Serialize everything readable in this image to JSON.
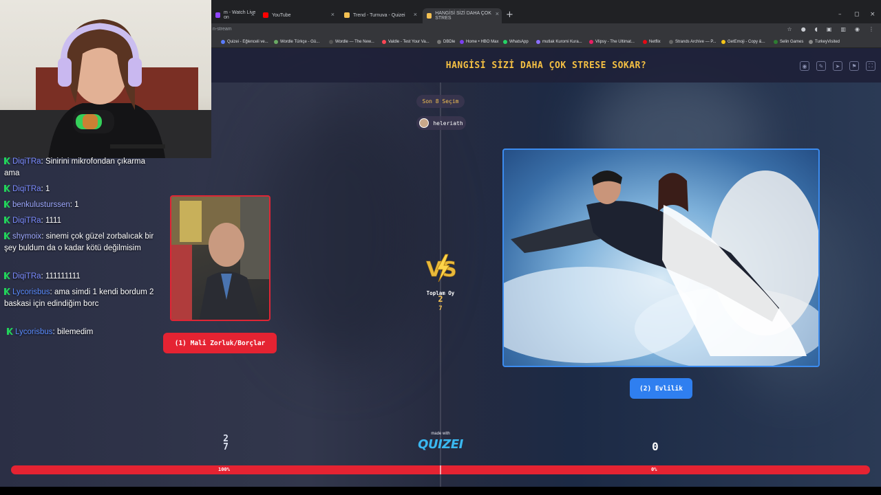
{
  "browser": {
    "tabs": [
      {
        "title": "m - Watch Live on",
        "favicon_color": "#9146ff",
        "active": false
      },
      {
        "title": "YouTube",
        "favicon_color": "#ff0000",
        "active": false
      },
      {
        "title": "Trend - Turnuva - Quizei",
        "favicon_color": "#f3c052",
        "active": false
      },
      {
        "title": "HANGİSİ SİZİ DAHA ÇOK STRES",
        "favicon_color": "#f3c052",
        "active": true
      }
    ],
    "new_tab": "+",
    "url": "n-stream",
    "bookmarks": [
      {
        "label": "Quizei - Eğlenceli ve...",
        "color": "#5a7cff"
      },
      {
        "label": "Wordle Türkçe - Gü...",
        "color": "#6aaa64"
      },
      {
        "label": "Wordle — The New...",
        "color": "#555"
      },
      {
        "label": "Valdle - Test Your Va...",
        "color": "#ff4655"
      },
      {
        "label": "DBDle",
        "color": "#777"
      },
      {
        "label": "Home • HBO Max",
        "color": "#7b3ff2"
      },
      {
        "label": "WhatsApp",
        "color": "#25d366"
      },
      {
        "label": "mutlak Kuromi Kura...",
        "color": "#8a6fff"
      },
      {
        "label": "Vlipsy - The Ultimat...",
        "color": "#e91e63"
      },
      {
        "label": "Netflix",
        "color": "#e50914"
      },
      {
        "label": "Strands Archive — P...",
        "color": "#666"
      },
      {
        "label": "GetEmoji - Copy &...",
        "color": "#f5c518"
      },
      {
        "label": "Selin Games",
        "color": "#2e7d32"
      },
      {
        "label": "TurkeyVisited",
        "color": "#888"
      }
    ]
  },
  "quiz": {
    "title": "HANGİSİ SİZİ DAHA ÇOK STRESE SOKAR?",
    "round_label": "Son 8 Seçim",
    "user": "heleriath",
    "left_option": "(1) Mali Zorluk/Borçlar",
    "right_option": "(2) Evlilik",
    "vs_text": "VS",
    "total_votes_label": "Toplam Oy",
    "total_votes_value": "2",
    "total_votes_sub": "7",
    "left_count": "2",
    "left_count_sub": "7",
    "right_count": "0",
    "left_percent": "100%",
    "right_percent": "0%",
    "left_share": 1.0,
    "made_with": "made with",
    "logo": "QUIZEI",
    "colors": {
      "title": "#f5c043",
      "left": "#e52332",
      "right": "#2f7ff0"
    }
  },
  "chat": [
    {
      "user": "DiqiTRa",
      "text": "Sinirini mikrofondan çıkarma ama"
    },
    {
      "user": "DiqiTRa",
      "text": "1"
    },
    {
      "user": "benkulusturssen",
      "text": "1"
    },
    {
      "user": "DiqiTRa",
      "text": "1111"
    },
    {
      "user": "shymoix",
      "text": "sinemi çok güzel zorbalıcak bir şey buldum da o kadar kötü değilmisim"
    },
    {
      "user": "DiqiTRa",
      "text": "111111111"
    },
    {
      "user": "Lycorisbus",
      "text": "ama simdi 1 kendi bordum 2 baskasi için edindiğim borc"
    },
    {
      "user": "Lycorisbus",
      "text": "bilemedim"
    }
  ]
}
